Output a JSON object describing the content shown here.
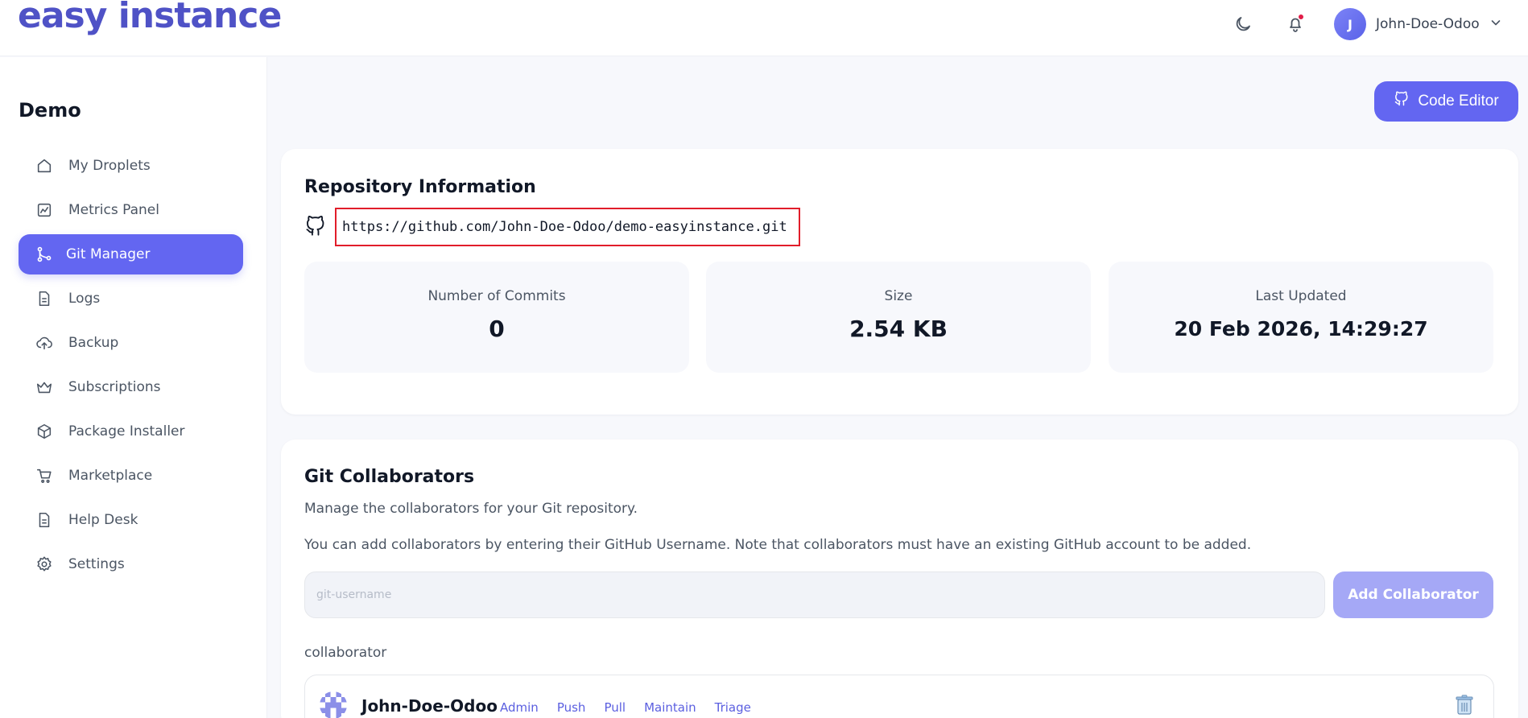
{
  "app": {
    "logo_text": "easy instance"
  },
  "header": {
    "theme_toggle_icon": "moon-icon",
    "notifications_icon": "bell-icon",
    "user": {
      "initial": "J",
      "name": "John-Doe-Odoo"
    }
  },
  "sidebar": {
    "project_title": "Demo",
    "items": [
      {
        "label": "My Droplets",
        "icon": "home-icon",
        "active": false
      },
      {
        "label": "Metrics Panel",
        "icon": "chart-icon",
        "active": false
      },
      {
        "label": "Git Manager",
        "icon": "git-branch-icon",
        "active": true
      },
      {
        "label": "Logs",
        "icon": "document-icon",
        "active": false
      },
      {
        "label": "Backup",
        "icon": "cloud-upload-icon",
        "active": false
      },
      {
        "label": "Subscriptions",
        "icon": "crown-icon",
        "active": false
      },
      {
        "label": "Package Installer",
        "icon": "package-icon",
        "active": false
      },
      {
        "label": "Marketplace",
        "icon": "cart-icon",
        "active": false
      },
      {
        "label": "Help Desk",
        "icon": "document-icon",
        "active": false
      },
      {
        "label": "Settings",
        "icon": "gear-icon",
        "active": false
      }
    ]
  },
  "toolbar": {
    "code_editor_label": "Code Editor"
  },
  "repository": {
    "title": "Repository Information",
    "url": "https://github.com/John-Doe-Odoo/demo-easyinstance.git",
    "stats": [
      {
        "label": "Number of Commits",
        "value": "0"
      },
      {
        "label": "Size",
        "value": "2.54 KB"
      },
      {
        "label": "Last Updated",
        "value": "20 Feb 2026, 14:29:27"
      }
    ]
  },
  "collaborators": {
    "title": "Git Collaborators",
    "description": "Manage the collaborators for your Git repository.",
    "note": "You can add collaborators by entering their GitHub Username. Note that collaborators must have an existing GitHub account to be added.",
    "input_placeholder": "git-username",
    "add_button_label": "Add Collaborator",
    "section_label": "collaborator",
    "list": [
      {
        "name": "John-Doe-Odoo",
        "permissions": [
          "Admin",
          "Push",
          "Pull",
          "Maintain",
          "Triage"
        ]
      }
    ]
  },
  "colors": {
    "accent": "#6366f1",
    "logo": "#4f52c6",
    "highlight_border": "#e11d2a",
    "notification_dot": "#e11d48"
  }
}
